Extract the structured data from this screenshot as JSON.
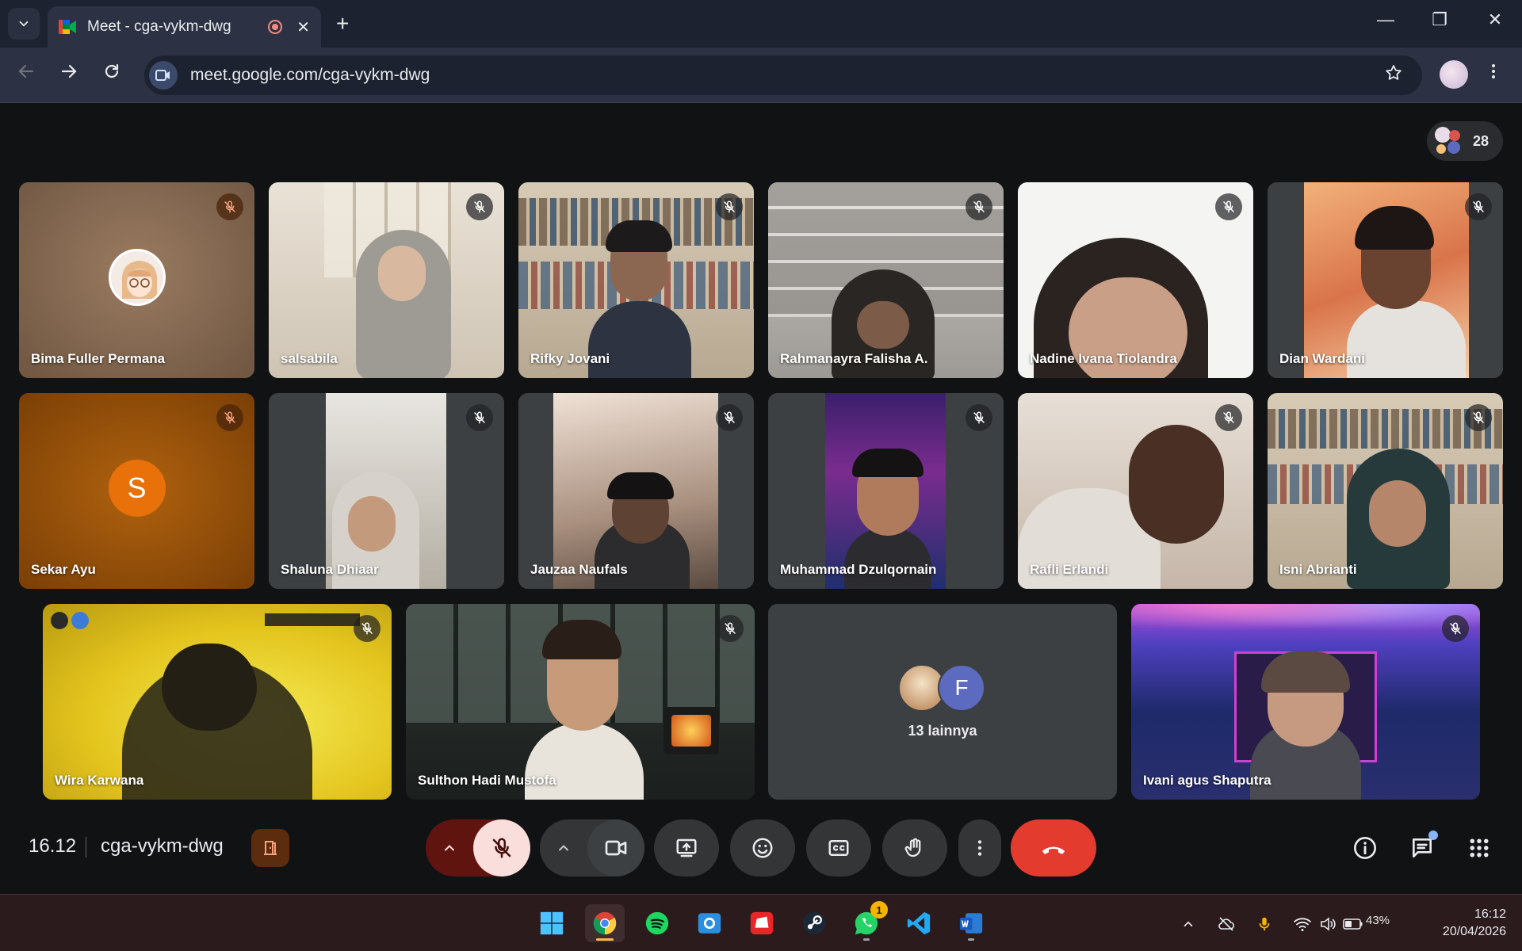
{
  "browser": {
    "tab_title": "Meet - cga-vykm-dwg",
    "new_tab_symbol": "+",
    "close_tab_symbol": "✕",
    "url": "meet.google.com/cga-vykm-dwg",
    "window_minimize": "—",
    "window_restore": "❐",
    "window_close": "✕"
  },
  "meet": {
    "participant_count": "28",
    "tiles": [
      {
        "name": "Bima Fuller Permana",
        "muted": true
      },
      {
        "name": "salsabila",
        "muted": true
      },
      {
        "name": "Rifky Jovani",
        "muted": true
      },
      {
        "name": "Rahmanayra Falisha A.",
        "muted": true
      },
      {
        "name": "Nadine Ivana Tiolandra",
        "muted": true
      },
      {
        "name": "Dian Wardani",
        "muted": true
      },
      {
        "name": "Sekar Ayu",
        "muted": true,
        "avatar_letter": "S"
      },
      {
        "name": "Shaluna Dhiaar",
        "muted": true
      },
      {
        "name": "Jauzaa Naufals",
        "muted": true
      },
      {
        "name": "Muhammad Dzulqornain",
        "muted": true
      },
      {
        "name": "Rafli Erlandi",
        "muted": true
      },
      {
        "name": "Isni Abrianti",
        "muted": true
      },
      {
        "name": "Wira Karwana",
        "muted": true
      },
      {
        "name": "Sulthon Hadi Mustofa",
        "muted": true
      },
      {
        "name": "Ivani agus Shaputra",
        "muted": true
      }
    ],
    "others": {
      "label": "13 lainnya",
      "avatar_letter": "F"
    },
    "bottom": {
      "time": "16.12",
      "meeting_code": "cga-vykm-dwg"
    }
  },
  "taskbar": {
    "whatsapp_badge": "1",
    "battery": "43%",
    "time": "16:12",
    "date": "20/04/2026"
  },
  "colors": {
    "end_call": "#e33b2e",
    "mic_off": "#f9dedc",
    "accent_blue": "#8ab4f8"
  }
}
